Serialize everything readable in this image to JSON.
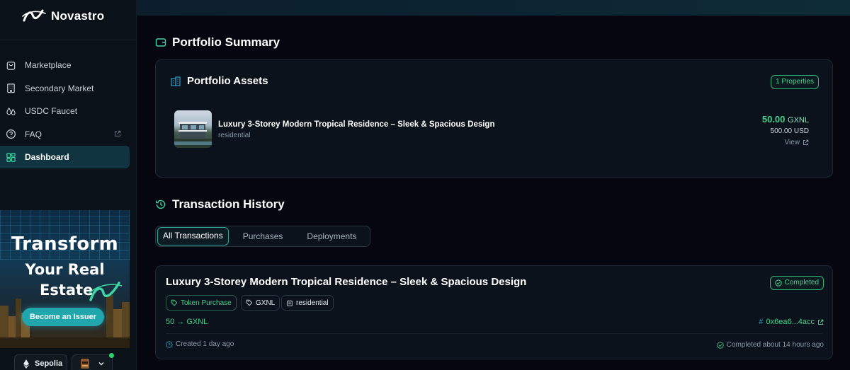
{
  "brand": {
    "name": "Novastro"
  },
  "sidebar": {
    "items": [
      {
        "label": "Marketplace",
        "icon": "shopping-bag-icon"
      },
      {
        "label": "Secondary Market",
        "icon": "building-icon"
      },
      {
        "label": "USDC Faucet",
        "icon": "droplets-icon"
      },
      {
        "label": "FAQ",
        "icon": "help-circle-icon"
      },
      {
        "label": "Dashboard",
        "icon": "dashboard-icon",
        "active": true
      }
    ],
    "promo": {
      "line1": "Transform",
      "line2": "Your Real",
      "line3": "Estate",
      "cta": "Become an Issuer"
    },
    "network": "Sepolia"
  },
  "portfolio": {
    "title": "Portfolio Summary",
    "assets_title": "Portfolio Assets",
    "count_badge": "1 Properties",
    "asset": {
      "name": "Luxury 3-Storey Modern Tropical Residence – Sleek & Spacious Design",
      "category": "residential",
      "amount": "50.00",
      "unit": "GXNL",
      "usd": "500.00 USD",
      "view": "View"
    }
  },
  "history": {
    "title": "Transaction History",
    "tabs": [
      "All Transactions",
      "Purchases",
      "Deployments"
    ],
    "active_tab": "All Transactions",
    "tx": {
      "title": "Luxury 3-Storey Modern Tropical Residence – Sleek & Spacious Design",
      "status": "Completed",
      "tags": [
        "Token Purchase",
        "GXNL",
        "residential"
      ],
      "amount": "50 → GXNL",
      "hash": "0x6ea6...4acc",
      "created": "Created 1 day ago",
      "completed": "Completed about 14 hours ago"
    }
  },
  "colors": {
    "accent": "#47d18e",
    "teal": "#21a6ad",
    "background": "#05060f"
  }
}
